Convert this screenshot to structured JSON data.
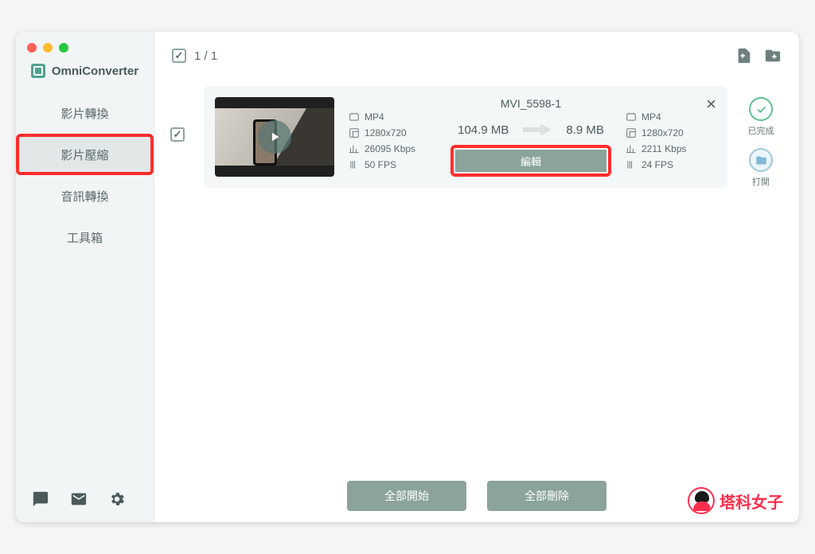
{
  "app": {
    "name": "OmniConverter"
  },
  "sidebar": {
    "items": [
      {
        "label": "影片轉換"
      },
      {
        "label": "影片壓縮"
      },
      {
        "label": "音訊轉換"
      },
      {
        "label": "工具箱"
      }
    ]
  },
  "topbar": {
    "counter": "1 / 1"
  },
  "file": {
    "name": "MVI_5598-1",
    "source": {
      "format": "MP4",
      "resolution": "1280x720",
      "bitrate": "26095 Kbps",
      "fps": "50 FPS"
    },
    "target": {
      "format": "MP4",
      "resolution": "1280x720",
      "bitrate": "2211 Kbps",
      "fps": "24 FPS"
    },
    "size_before": "104.9 MB",
    "size_after": "8.9 MB",
    "edit_label": "編輯"
  },
  "actions": {
    "done": "已完成",
    "open": "打開"
  },
  "footer": {
    "start_all": "全部開始",
    "delete_all": "全部刪除"
  },
  "watermark": "塔科女子"
}
